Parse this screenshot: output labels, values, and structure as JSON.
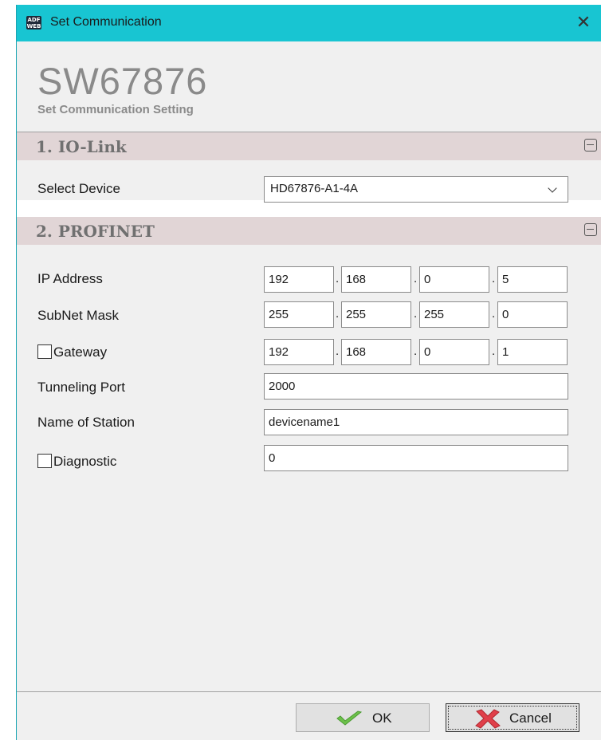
{
  "window": {
    "title": "Set Communication",
    "icon_text": "ADF WEB",
    "close_symbol": "✕"
  },
  "header": {
    "product": "SW67876",
    "subtitle": "Set Communication Setting"
  },
  "sections": {
    "iolink": {
      "title": "1. IO-Link",
      "select_device_label": "Select Device",
      "select_device_value": "HD67876-A1-4A"
    },
    "profinet": {
      "title": "2. PROFINET",
      "ip_label": "IP Address",
      "ip": [
        "192",
        "168",
        "0",
        "5"
      ],
      "subnet_label": "SubNet Mask",
      "subnet": [
        "255",
        "255",
        "255",
        "0"
      ],
      "gateway_label": "Gateway",
      "gateway_checked": false,
      "gateway": [
        "192",
        "168",
        "0",
        "1"
      ],
      "tunneling_label": "Tunneling Port",
      "tunneling_value": "2000",
      "station_label": "Name of Station",
      "station_value": "devicename1",
      "diagnostic_label": "Diagnostic",
      "diagnostic_checked": false,
      "diagnostic_value": "0"
    }
  },
  "buttons": {
    "ok": "OK",
    "cancel": "Cancel"
  },
  "colors": {
    "titlebar": "#18c5d2",
    "section_header": "#e1d5d6",
    "panel": "#f0f0f0",
    "ok_check": "#6cc04a",
    "cancel_x": "#e0404a"
  },
  "icons": {
    "app": "adfweb-logo-icon",
    "close": "close-icon",
    "collapse": "collapse-minus-icon",
    "dropdown": "chevron-down-icon",
    "ok": "checkmark-icon",
    "cancel": "red-x-icon"
  }
}
